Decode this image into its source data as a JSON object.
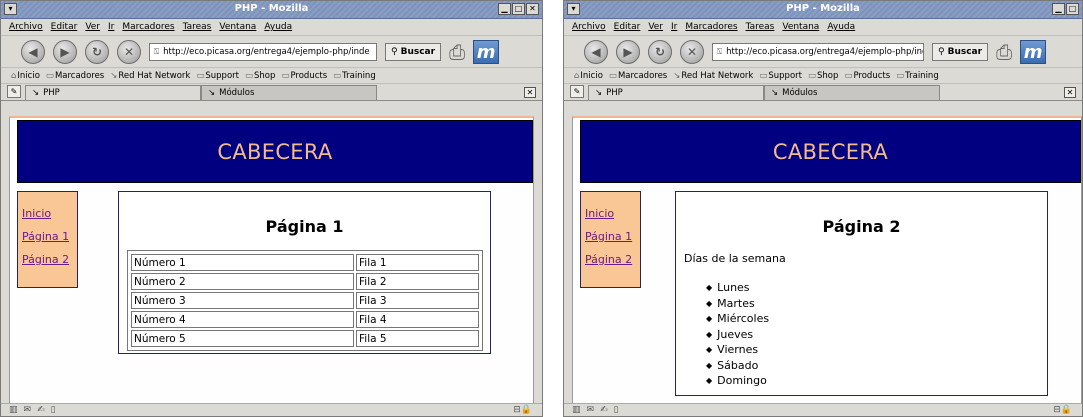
{
  "windows": [
    {
      "title": "PHP - Mozilla",
      "menu": [
        "Archivo",
        "Editar",
        "Ver",
        "Ir",
        "Marcadores",
        "Tareas",
        "Ventana",
        "Ayuda"
      ],
      "url": "http://eco.picasa.org/entrega4/ejemplo-php/inde",
      "search_label": "Buscar",
      "bookmarks": [
        "Inicio",
        "Marcadores",
        "Red Hat Network",
        "Support",
        "Shop",
        "Products",
        "Training"
      ],
      "tabs": [
        "PHP",
        "Módulos"
      ],
      "header": "CABECERA",
      "sidebar_links": [
        "Inicio",
        "Página 1",
        "Página 2"
      ],
      "page_title": "Página 1",
      "table_rows": [
        [
          "Número 1",
          "Fila 1"
        ],
        [
          "Número 2",
          "Fila 2"
        ],
        [
          "Número 3",
          "Fila 3"
        ],
        [
          "Número 4",
          "Fila 4"
        ],
        [
          "Número 5",
          "Fila 5"
        ]
      ]
    },
    {
      "title": "PHP - Mozilla",
      "menu": [
        "Archivo",
        "Editar",
        "Ver",
        "Ir",
        "Marcadores",
        "Tareas",
        "Ventana",
        "Ayuda"
      ],
      "url": "http://eco.picasa.org/entrega4/ejemplo-php/inde",
      "search_label": "Buscar",
      "bookmarks": [
        "Inicio",
        "Marcadores",
        "Red Hat Network",
        "Support",
        "Shop",
        "Products",
        "Training"
      ],
      "tabs": [
        "PHP",
        "Módulos"
      ],
      "header": "CABECERA",
      "sidebar_links": [
        "Inicio",
        "Página 1",
        "Página 2"
      ],
      "page_title": "Página 2",
      "intro": "Días de la semana",
      "days": [
        "Lunes",
        "Martes",
        "Miércoles",
        "Jueves",
        "Viernes",
        "Sábado",
        "Domingo"
      ]
    }
  ],
  "colors": {
    "header_bg": "#000080",
    "header_text": "#f4bb8a",
    "sidebar_bg": "#f9c795",
    "link": "#6b1a8a"
  }
}
